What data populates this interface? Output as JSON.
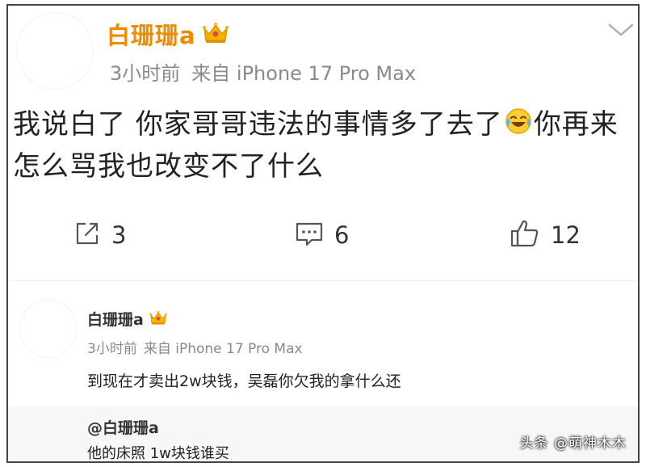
{
  "post": {
    "username": "白珊珊a",
    "time": "3小时前",
    "source": "来自 iPhone 17 Pro Max",
    "text_before_emoji": "我说白了 你家哥哥违法的事情多了去了",
    "text_after_emoji": "你再来怎么骂我也改变不了什么",
    "emoji_icon": "laugh-cry-emoji-icon",
    "actions": {
      "share_count": "3",
      "comment_count": "6",
      "like_count": "12"
    }
  },
  "comment": {
    "username": "白珊珊a",
    "time": "3小时前",
    "source": "来自 iPhone 17 Pro Max",
    "text": "到现在才卖出2w块钱，吴磊你欠我的拿什么还"
  },
  "quote": {
    "user": "@白珊珊a",
    "text": "他的床照 1w块钱谁买"
  },
  "watermark": "头条 @萌神木木",
  "colors": {
    "username_orange": "#f08a00",
    "meta_gray": "#8a8a8a",
    "quote_bg": "#f7f7f7"
  }
}
